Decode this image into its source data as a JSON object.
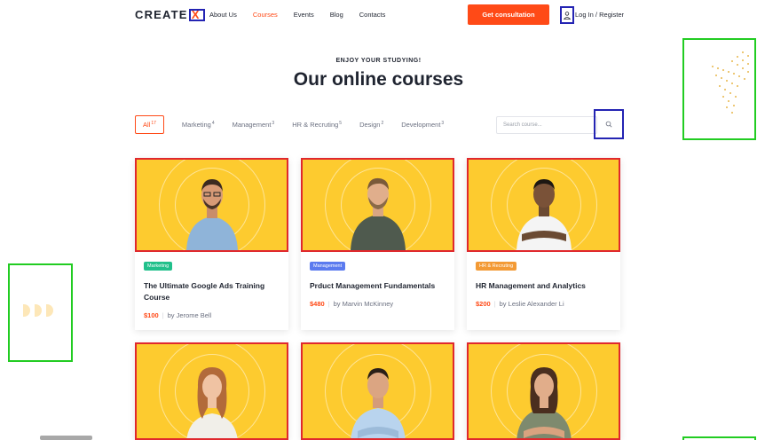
{
  "header": {
    "logo_text": "CREATE",
    "logo_mark": "X",
    "nav": [
      "About Us",
      "Courses",
      "Events",
      "Blog",
      "Contacts"
    ],
    "active_nav": "Courses",
    "cta_label": "Get consultation",
    "login_label": "Log In / Register"
  },
  "section": {
    "kicker": "ENJOY YOUR STUDYING!",
    "title": "Our online courses"
  },
  "tabs": [
    {
      "label": "All",
      "count": "17"
    },
    {
      "label": "Marketing",
      "count": "4"
    },
    {
      "label": "Management",
      "count": "3"
    },
    {
      "label": "HR & Recruting",
      "count": "5"
    },
    {
      "label": "Design",
      "count": "2"
    },
    {
      "label": "Development",
      "count": "3"
    }
  ],
  "search": {
    "placeholder": "Search course..."
  },
  "courses": [
    {
      "category": "Marketing",
      "category_color": "#21c08b",
      "title": "The Ultimate Google Ads Training Course",
      "price": "$100",
      "author": "by Jerome Bell"
    },
    {
      "category": "Management",
      "category_color": "#5b7bef",
      "title": "Prduct Management Fundamentals",
      "price": "$480",
      "author": "by Marvin McKinney"
    },
    {
      "category": "HR & Recruting",
      "category_color": "#f39a35",
      "title": "HR  Management and Analytics",
      "price": "$200",
      "author": "by Leslie Alexander Li"
    }
  ],
  "colors": {
    "accent": "#ff4a17",
    "card_bg": "#fdcb2f",
    "heading": "#1f2430"
  }
}
